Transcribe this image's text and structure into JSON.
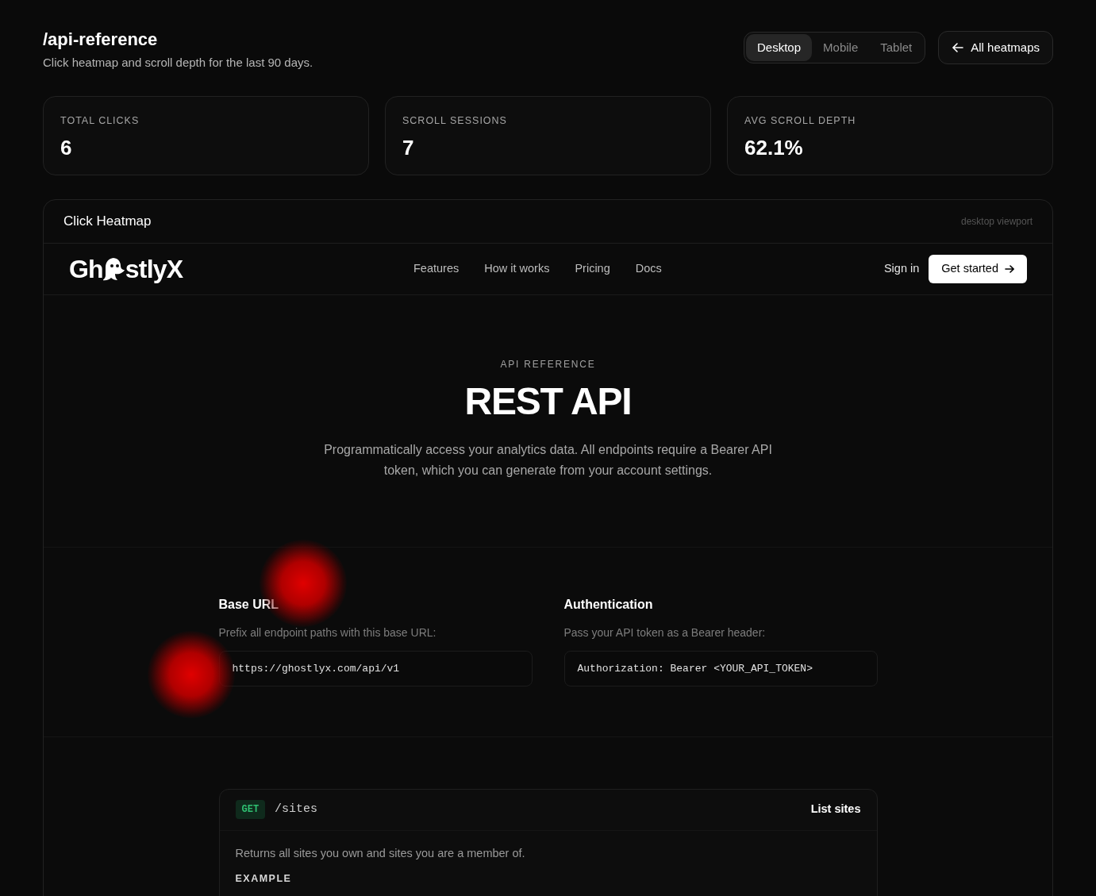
{
  "page": {
    "title": "/api-reference",
    "subtitle": "Click heatmap and scroll depth for the last 90 days."
  },
  "device_tabs": [
    {
      "label": "Desktop",
      "selected": true
    },
    {
      "label": "Mobile",
      "selected": false
    },
    {
      "label": "Tablet",
      "selected": false
    }
  ],
  "back_button": "All heatmaps",
  "stats": [
    {
      "label": "TOTAL CLICKS",
      "value": "6"
    },
    {
      "label": "SCROLL SESSIONS",
      "value": "7"
    },
    {
      "label": "AVG SCROLL DEPTH",
      "value": "62.1%"
    }
  ],
  "heatmap": {
    "title": "Click Heatmap",
    "viewport": "desktop viewport",
    "site": {
      "logo": {
        "before": "Gh",
        "after": "stlyX"
      },
      "nav": [
        "Features",
        "How it works",
        "Pricing",
        "Docs"
      ],
      "sign_in": "Sign in",
      "cta": "Get started",
      "eyebrow": "API REFERENCE",
      "heading": "REST API",
      "intro": "Programmatically access your analytics data. All endpoints require a Bearer API token, which you can generate from your account settings.",
      "sections": [
        {
          "title": "Base URL",
          "description": "Prefix all endpoint paths with this base URL:",
          "code": "https://ghostlyx.com/api/v1"
        },
        {
          "title": "Authentication",
          "description": "Pass your API token as a Bearer header:",
          "code": "Authorization: Bearer <YOUR_API_TOKEN>"
        }
      ],
      "endpoint": {
        "method": "GET",
        "path": "/sites",
        "summary": "List sites",
        "description": "Returns all sites you own and sites you are a member of.",
        "example_label": "EXAMPLE"
      }
    }
  }
}
